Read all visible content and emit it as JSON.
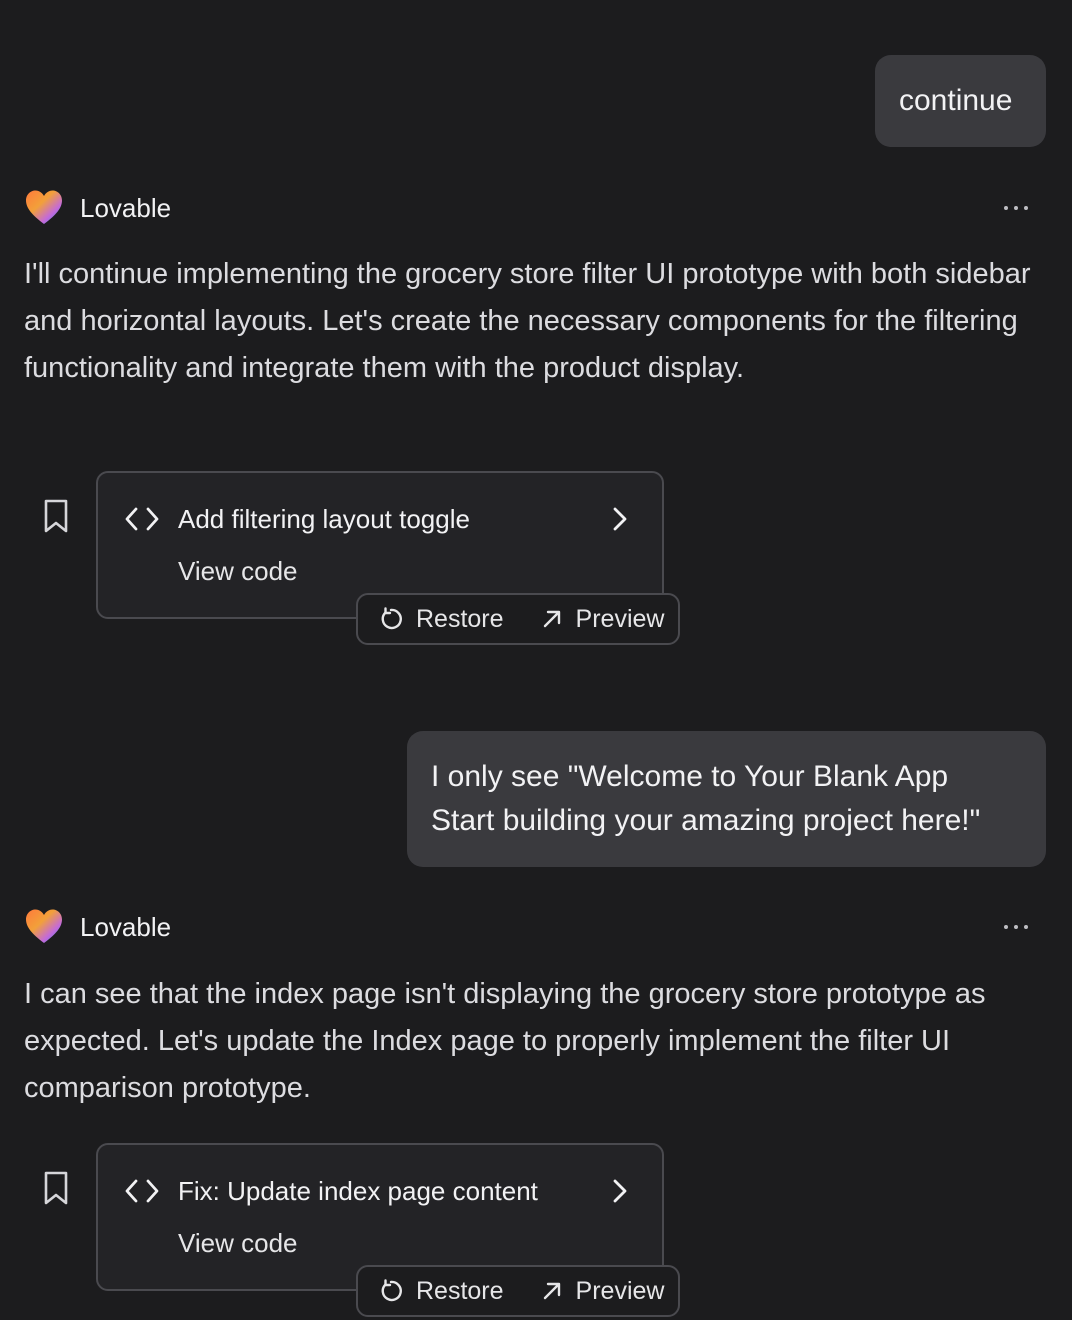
{
  "messages": {
    "user_1": {
      "text": "continue"
    },
    "assistant_1": {
      "name": "Lovable",
      "more_icon": "more-horizontal-icon",
      "text": "I'll continue implementing the grocery store filter UI prototype with both sidebar and horizontal layouts. Let's create the necessary components for the filtering functionality and integrate them with the product display.",
      "card": {
        "title": "Add filtering layout toggle",
        "view_code": "View code",
        "restore": "Restore",
        "preview": "Preview"
      }
    },
    "user_2": {
      "line1": "I only see \"Welcome to Your Blank App",
      "line2": "Start building your amazing project here!\""
    },
    "assistant_2": {
      "name": "Lovable",
      "text": "I can see that the index page isn't displaying the grocery store prototype as expected. Let's update the Index page to properly implement the filter UI comparison prototype.",
      "card": {
        "title": "Fix: Update index page content",
        "view_code": "View code",
        "restore": "Restore",
        "preview": "Preview"
      }
    }
  },
  "icons": {
    "logo": "lovable-heart-logo",
    "bookmark": "bookmark-icon",
    "code": "code-brackets-icon",
    "chevron": "chevron-right-icon",
    "restore": "restore-rotate-icon",
    "preview": "arrow-up-right-icon",
    "more": "more-horizontal-icon"
  },
  "colors": {
    "background": "#1c1c1e",
    "user_bubble": "#3a3a3e",
    "card_border": "#4a4a4f"
  }
}
